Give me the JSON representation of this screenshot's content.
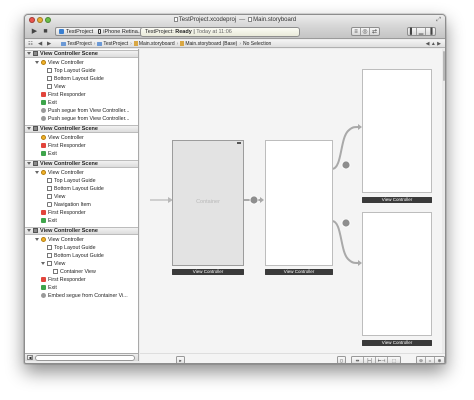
{
  "window": {
    "project_file": "TestProject.xcodeproj",
    "separator": "—",
    "storyboard_file": "Main.storyboard"
  },
  "toolbar": {
    "scheme_app": "TestProject",
    "scheme_device": "iPhone Retina...",
    "activity_project": "TestProject:",
    "activity_status": "Ready",
    "activity_divider": "|",
    "activity_time": "Today at 11:06"
  },
  "jumpbar": {
    "path": [
      "TestProject",
      "TestProject",
      "Main.storyboard",
      "Main.storyboard (Base)",
      "No Selection"
    ]
  },
  "outline": {
    "scenes": [
      {
        "header": "View Controller Scene",
        "rows": [
          {
            "text": "View Controller",
            "icon": "view-controller-icon",
            "indent": 1
          },
          {
            "text": "Top Layout Guide",
            "icon": "layout-guide-icon",
            "indent": 2
          },
          {
            "text": "Bottom Layout Guide",
            "icon": "layout-guide-icon",
            "indent": 2
          },
          {
            "text": "View",
            "icon": "view-icon",
            "indent": 2
          },
          {
            "text": "First Responder",
            "icon": "first-responder-icon",
            "indent": 1
          },
          {
            "text": "Exit",
            "icon": "exit-icon",
            "indent": 1
          },
          {
            "text": "Push segue from View Controller...",
            "icon": "segue-icon",
            "indent": 1
          },
          {
            "text": "Push segue from View Controller...",
            "icon": "segue-icon",
            "indent": 1
          }
        ]
      },
      {
        "header": "View Controller Scene",
        "rows": [
          {
            "text": "View Controller",
            "icon": "view-controller-icon",
            "indent": 1
          },
          {
            "text": "First Responder",
            "icon": "first-responder-icon",
            "indent": 1
          },
          {
            "text": "Exit",
            "icon": "exit-icon",
            "indent": 1
          }
        ]
      },
      {
        "header": "View Controller Scene",
        "rows": [
          {
            "text": "View Controller",
            "icon": "view-controller-icon",
            "indent": 1
          },
          {
            "text": "Top Layout Guide",
            "icon": "layout-guide-icon",
            "indent": 2
          },
          {
            "text": "Bottom Layout Guide",
            "icon": "layout-guide-icon",
            "indent": 2
          },
          {
            "text": "View",
            "icon": "view-icon",
            "indent": 2
          },
          {
            "text": "Navigation Item",
            "icon": "navigation-item-icon",
            "indent": 2
          },
          {
            "text": "First Responder",
            "icon": "first-responder-icon",
            "indent": 1
          },
          {
            "text": "Exit",
            "icon": "exit-icon",
            "indent": 1
          }
        ]
      },
      {
        "header": "View Controller Scene",
        "rows": [
          {
            "text": "View Controller",
            "icon": "view-controller-icon",
            "indent": 1
          },
          {
            "text": "Top Layout Guide",
            "icon": "layout-guide-icon",
            "indent": 2
          },
          {
            "text": "Bottom Layout Guide",
            "icon": "layout-guide-icon",
            "indent": 2
          },
          {
            "text": "View",
            "icon": "view-icon",
            "indent": 2
          },
          {
            "text": "Container View",
            "icon": "view-icon",
            "indent": 3
          },
          {
            "text": "First Responder",
            "icon": "first-responder-icon",
            "indent": 1
          },
          {
            "text": "Exit",
            "icon": "exit-icon",
            "indent": 1
          },
          {
            "text": "Embed segue from Container Vi...",
            "icon": "segue-icon",
            "indent": 1
          }
        ]
      }
    ]
  },
  "canvas": {
    "container_label": "Container",
    "controllers": [
      {
        "label": "View Controller"
      },
      {
        "label": "View Controller"
      },
      {
        "label": "View Controller"
      },
      {
        "label": "View Controller"
      }
    ]
  },
  "colors": {
    "accent_blue": "#3a7fd0",
    "first_responder": "#e2453c",
    "exit": "#3ea54b",
    "view_controller": "#f1b22a"
  }
}
